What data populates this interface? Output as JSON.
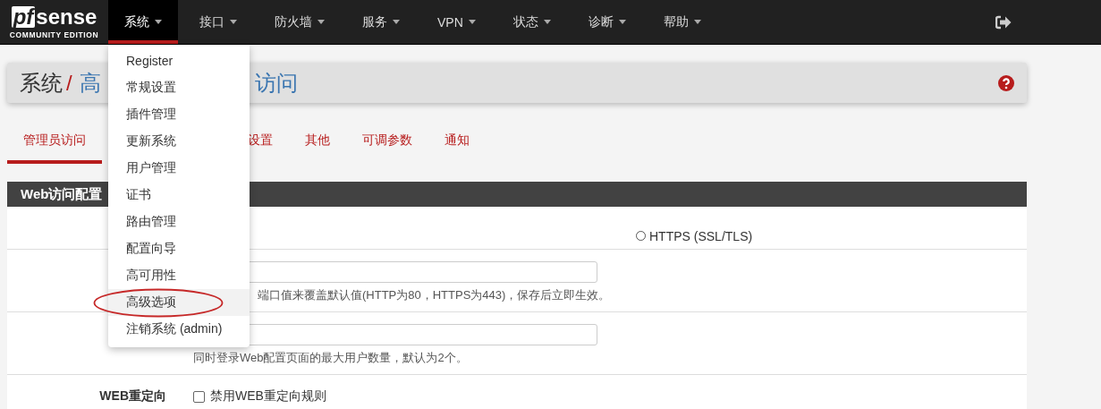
{
  "logo": {
    "prefix": "pf",
    "name": "sense",
    "edition": "COMMUNITY EDITION"
  },
  "navbar": {
    "items": [
      {
        "label": "系统",
        "selected": true
      },
      {
        "label": "接口",
        "selected": false
      },
      {
        "label": "防火墙",
        "selected": false
      },
      {
        "label": "服务",
        "selected": false
      },
      {
        "label": "VPN",
        "selected": false
      },
      {
        "label": "状态",
        "selected": false
      },
      {
        "label": "诊断",
        "selected": false
      },
      {
        "label": "帮助",
        "selected": false
      }
    ]
  },
  "dropdown": {
    "items": [
      {
        "label": "Register",
        "selected": false,
        "annotated": false
      },
      {
        "label": "常规设置",
        "selected": false,
        "annotated": false
      },
      {
        "label": "插件管理",
        "selected": false,
        "annotated": false
      },
      {
        "label": "更新系统",
        "selected": false,
        "annotated": false
      },
      {
        "label": "用户管理",
        "selected": false,
        "annotated": false
      },
      {
        "label": "证书",
        "selected": false,
        "annotated": false
      },
      {
        "label": "路由管理",
        "selected": false,
        "annotated": false
      },
      {
        "label": "配置向导",
        "selected": false,
        "annotated": false
      },
      {
        "label": "高可用性",
        "selected": false,
        "annotated": false
      },
      {
        "label": "高级选项",
        "selected": true,
        "annotated": true
      },
      {
        "label": "注销系统 (admin)",
        "selected": false,
        "annotated": false
      }
    ]
  },
  "breadcrumb": {
    "root": "系统",
    "separator": "/",
    "current_start": "高",
    "current_end": "访问"
  },
  "tabs": [
    {
      "label": "管理员访问",
      "selected": true
    },
    {
      "label": "设置",
      "selected": false
    },
    {
      "label": "其他",
      "selected": false
    },
    {
      "label": "可调参数",
      "selected": false
    },
    {
      "label": "通知",
      "selected": false
    }
  ],
  "panel": {
    "title": "Web访问配置",
    "rows": [
      {
        "kind": "radio",
        "label": "",
        "options": [
          {
            "label": "HTTPS (SSL/TLS)",
            "selected": false
          }
        ]
      },
      {
        "kind": "input",
        "label": "",
        "help": "端口值来覆盖默认值(HTTP为80，HTTPS为443)，保存后立即生效。"
      },
      {
        "kind": "input",
        "label": "",
        "help": "同时登录Web配置页面的最大用户数量，默认为2个。"
      },
      {
        "kind": "checkbox",
        "label": "WEB重定向",
        "text": "禁用WEB重定向规则",
        "checked": false
      }
    ]
  }
}
